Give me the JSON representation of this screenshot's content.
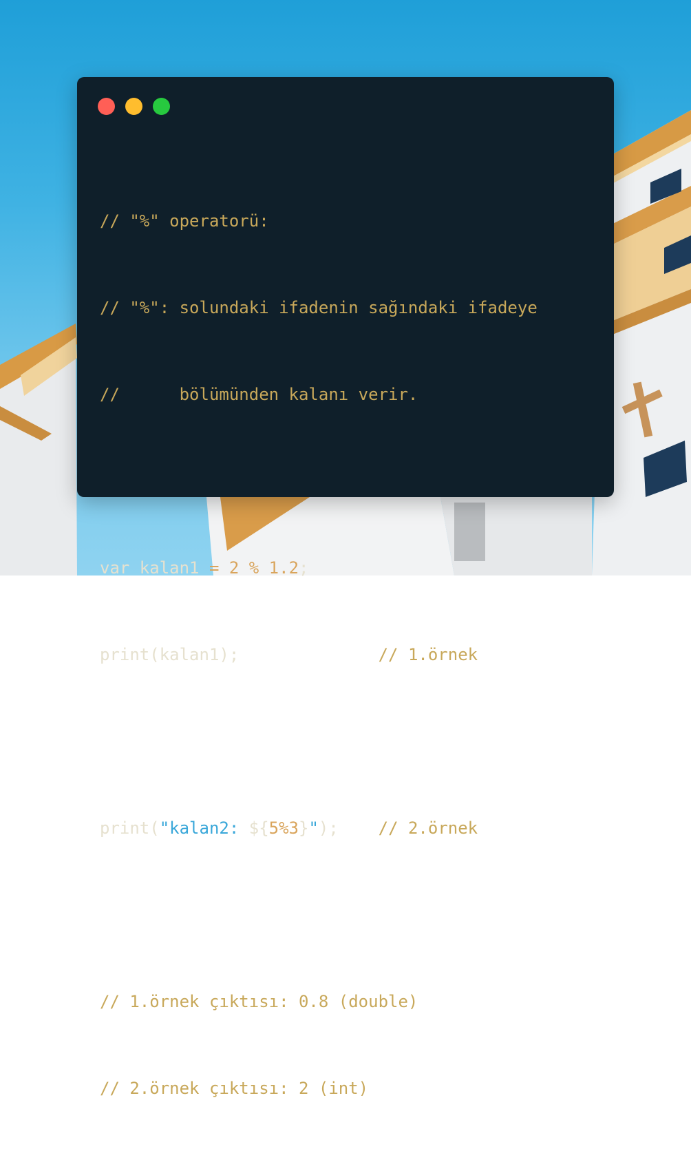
{
  "window": {
    "controls": [
      "close",
      "minimize",
      "maximize"
    ]
  },
  "code": {
    "lines": [
      {
        "comment": "// \"%\" operatorü:"
      },
      {
        "comment": "// \"%\": solundaki ifadenin sağındaki ifadeye"
      },
      {
        "comment": "//      bölümünden kalanı verir."
      },
      {
        "blank": true
      },
      {
        "kw": "var kalan1 ",
        "op1": "= ",
        "n1": "2 ",
        "op2": "% ",
        "n2": "1.2",
        "plain": ";"
      },
      {
        "plain": "print(kalan1);",
        "pad": "              ",
        "comment": "// 1.örnek"
      },
      {
        "blank": true
      },
      {
        "p1": "print(",
        "s1": "\"kalan2: ",
        "p2": "${",
        "n": "5%3",
        "p3": "}",
        "s2": "\"",
        "p4": ");",
        "pad": "    ",
        "comment": "// 2.örnek"
      },
      {
        "blank": true
      },
      {
        "comment": "// 1.örnek çıktısı: 0.8 (double)"
      },
      {
        "comment": "// 2.örnek çıktısı: 2 (int)"
      }
    ]
  },
  "colors": {
    "window_bg": "#0f1f2a",
    "comment": "#c8a85a",
    "number": "#d9a45b",
    "string": "#39a7d9",
    "text": "#e6e1cf"
  }
}
